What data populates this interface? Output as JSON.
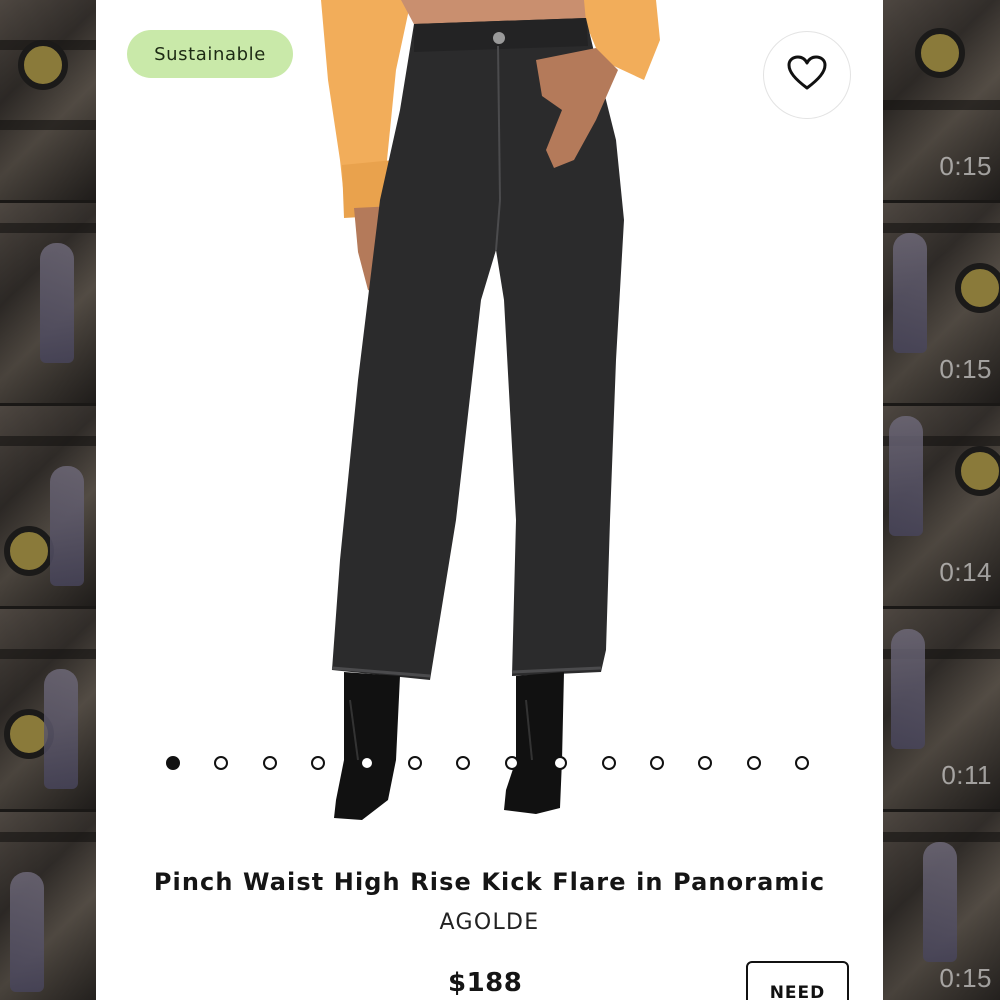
{
  "product": {
    "badge": "Sustainable",
    "title": "Pinch Waist High Rise Kick Flare in Panoramic",
    "brand": "AGOLDE",
    "price": "$188",
    "need_button_label": "NEED",
    "favorite_icon": "heart-outline-icon",
    "image_count": 14,
    "active_image_index": 0
  },
  "side_videos": {
    "left": [
      {
        "duration": ""
      },
      {
        "duration": ""
      },
      {
        "duration": ""
      },
      {
        "duration": ""
      },
      {
        "duration": ""
      }
    ],
    "right": [
      {
        "duration": "0:15"
      },
      {
        "duration": "0:15"
      },
      {
        "duration": "0:14"
      },
      {
        "duration": "0:11"
      },
      {
        "duration": "0:15"
      }
    ]
  },
  "colors": {
    "badge_bg": "#c9e9a9",
    "sweater": "#f2ad5a",
    "denim": "#2b2b2c",
    "page_bg": "#ffffff"
  }
}
